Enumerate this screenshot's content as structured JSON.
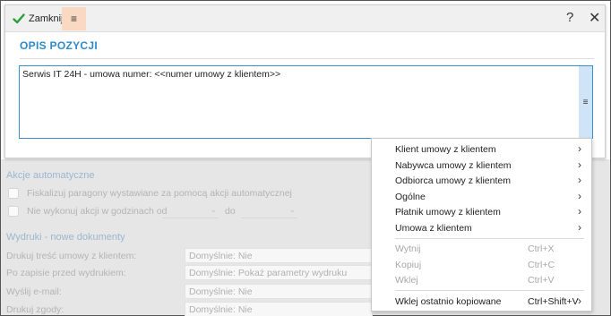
{
  "toolbar": {
    "close_label": "Zamknij",
    "menu_glyph": "≡",
    "help_glyph": "?",
    "close_x_glyph": "✕"
  },
  "dialog": {
    "section_title": "OPIS POZYCJI",
    "text_value": "Serwis IT 24H - umowa numer: <<numer umowy z klientem>>",
    "area_menu_glyph": "≡"
  },
  "background_form": {
    "auto_actions_title": "Akcje automatyczne",
    "fiscalize_label": "Fiskalizuj paragony wystawiane za pomocą akcji automatycznej",
    "no_action_label": "Nie wykonuj akcji w godzinach od",
    "to_label": "do",
    "prints_title": "Wydruki - nowe dokumenty",
    "rows": [
      {
        "label": "Drukuj treść umowy z klientem:",
        "value": "Domyślnie: Nie"
      },
      {
        "label": "Po zapisie przed wydrukiem:",
        "value": "Domyślnie: Pokaż parametry wydruku"
      },
      {
        "label": "Wyślij e-mail:",
        "value": "Domyślnie: Nie"
      },
      {
        "label": "Drukuj zgody:",
        "value": "Domyślnie: Nie"
      }
    ]
  },
  "context_menu": {
    "submenus": [
      {
        "label": "Klient umowy z klientem",
        "arrow": "›"
      },
      {
        "label": "Nabywca umowy z klientem",
        "arrow": "›"
      },
      {
        "label": "Odbiorca umowy z klientem",
        "arrow": "›"
      },
      {
        "label": "Ogólne",
        "arrow": "›"
      },
      {
        "label": "Płatnik umowy z klientem",
        "arrow": "›"
      },
      {
        "label": "Umowa z klientem",
        "arrow": "›"
      }
    ],
    "edit_items": [
      {
        "label": "Wytnij",
        "shortcut": "Ctrl+X"
      },
      {
        "label": "Kopiuj",
        "shortcut": "Ctrl+C"
      },
      {
        "label": "Wklej",
        "shortcut": "Ctrl+V"
      }
    ],
    "paste_last": {
      "label": "Wklej ostatnio kopiowane",
      "shortcut": "Ctrl+Shift+V",
      "arrow": "›"
    }
  },
  "colors": {
    "accent": "#2f8ac8",
    "check_green": "#2e9e3a",
    "menu_button_bg": "#f9d9c2",
    "text_area_border": "#3b8fd1"
  }
}
